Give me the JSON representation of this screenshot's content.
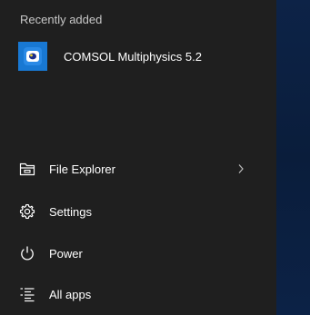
{
  "start_menu": {
    "section_header": "Recently added",
    "recent_apps": [
      {
        "label": "COMSOL Multiphysics 5.2",
        "icon": "comsol-app-icon"
      }
    ],
    "nav_items": [
      {
        "label": "File Explorer",
        "icon": "folder-icon",
        "has_submenu": true
      },
      {
        "label": "Settings",
        "icon": "gear-icon"
      },
      {
        "label": "Power",
        "icon": "power-icon"
      },
      {
        "label": "All apps",
        "icon": "all-apps-icon"
      }
    ]
  },
  "colors": {
    "menu_background": "#1f1f1f",
    "desktop_background": "#0b1a33",
    "app_tile": "#1878d3",
    "text_primary": "#ffffff",
    "text_secondary": "#c8c8c8"
  }
}
